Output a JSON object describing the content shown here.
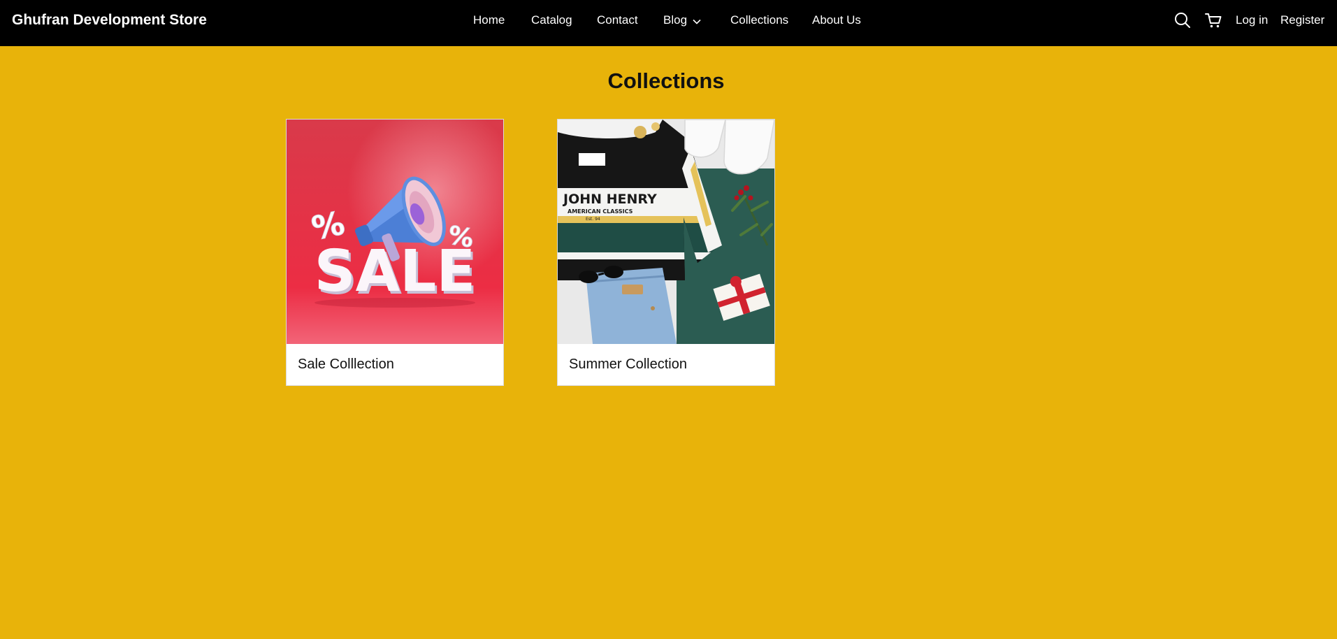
{
  "header": {
    "brand": "Ghufran Development Store",
    "nav": [
      {
        "label": "Home"
      },
      {
        "label": "Catalog"
      },
      {
        "label": "Contact"
      },
      {
        "label": "Blog"
      },
      {
        "label": "Collections"
      },
      {
        "label": "About Us"
      }
    ],
    "icons": {
      "search": "search-icon",
      "cart": "cart-icon",
      "dropdown": "chevron-down-icon"
    },
    "login_label": "Log in",
    "register_label": "Register"
  },
  "main": {
    "title": "Collections",
    "collections": [
      {
        "label": "Sale Colllection",
        "image": {
          "text": "SALE",
          "percent": "%"
        }
      },
      {
        "label": "Summer Collection",
        "image": {
          "shirt_text": "JOHN HENRY",
          "shirt_subtext": "AMERICAN CLASSICS",
          "shirt_year": "Est. 94"
        }
      }
    ]
  },
  "colors": {
    "header_bg": "#000000",
    "page_bg": "#E8B30A",
    "card_bg": "#FFFFFF"
  }
}
